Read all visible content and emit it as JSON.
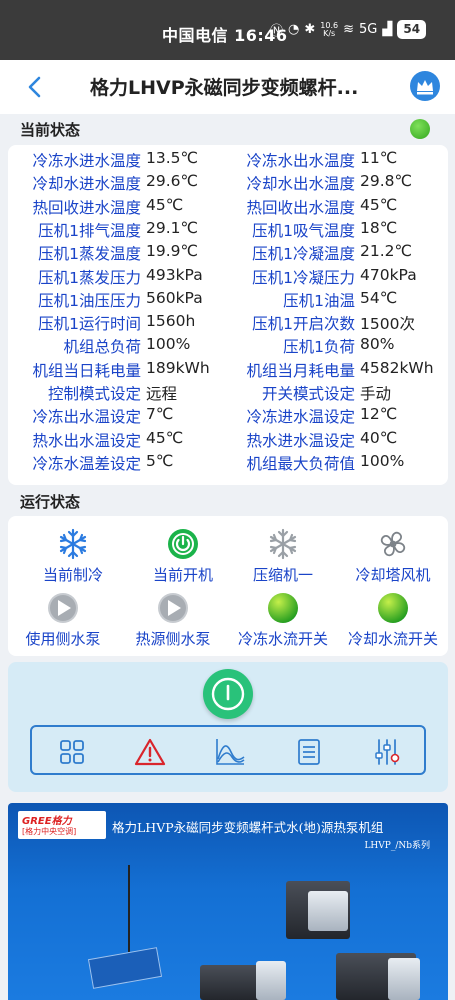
{
  "statusbar": {
    "carrier_time": "中国电信 16:46",
    "net_speed": "10.6\nK/s",
    "signal": "5G",
    "battery": "54"
  },
  "header": {
    "title": "格力LHVP永磁同步变频螺杆..."
  },
  "current_status": {
    "title": "当前状态",
    "rows": [
      {
        "l1": "冷冻水进水温度",
        "v1": "13.5℃",
        "l2": "冷冻水出水温度",
        "v2": "11℃"
      },
      {
        "l1": "冷却水进水温度",
        "v1": "29.6℃",
        "l2": "冷却水出水温度",
        "v2": "29.8℃"
      },
      {
        "l1": "热回收进水温度",
        "v1": "45℃",
        "l2": "热回收出水温度",
        "v2": "45℃"
      },
      {
        "l1": "压机1排气温度",
        "v1": "29.1℃",
        "l2": "压机1吸气温度",
        "v2": "18℃"
      },
      {
        "l1": "压机1蒸发温度",
        "v1": "19.9℃",
        "l2": "压机1冷凝温度",
        "v2": "21.2℃"
      },
      {
        "l1": "压机1蒸发压力",
        "v1": "493kPa",
        "l2": "压机1冷凝压力",
        "v2": "470kPa"
      },
      {
        "l1": "压机1油压压力",
        "v1": "560kPa",
        "l2": "压机1油温",
        "v2": "54℃"
      },
      {
        "l1": "压机1运行时间",
        "v1": "1560h",
        "l2": "压机1开启次数",
        "v2": "1500次"
      },
      {
        "l1": "机组总负荷",
        "v1": "100%",
        "l2": "压机1负荷",
        "v2": "80%"
      },
      {
        "l1": "机组当日耗电量",
        "v1": "189kWh",
        "l2": "机组当月耗电量",
        "v2": "4582kWh"
      },
      {
        "l1": "控制模式设定",
        "v1": "远程",
        "l2": "开关模式设定",
        "v2": "手动"
      },
      {
        "l1": "冷冻出水温设定",
        "v1": "7℃",
        "l2": "冷冻进水温设定",
        "v2": "12℃"
      },
      {
        "l1": "热水出水温设定",
        "v1": "45℃",
        "l2": "热水进水温设定",
        "v2": "40℃"
      },
      {
        "l1": "冷冻水温差设定",
        "v1": "5℃",
        "l2": "机组最大负荷值",
        "v2": "100%"
      }
    ]
  },
  "run_status": {
    "title": "运行状态",
    "items": [
      {
        "label": "当前制冷",
        "icon": "snowflake-icon"
      },
      {
        "label": "当前开机",
        "icon": "power-on-icon"
      },
      {
        "label": "压缩机一",
        "icon": "compressor-snowflake-icon"
      },
      {
        "label": "冷却塔风机",
        "icon": "fan-icon"
      },
      {
        "label": "使用侧水泵",
        "icon": "pump-icon"
      },
      {
        "label": "热源侧水泵",
        "icon": "pump-icon"
      },
      {
        "label": "冷冻水流开关",
        "icon": "flow-switch-icon"
      },
      {
        "label": "冷却水流开关",
        "icon": "flow-switch-icon"
      }
    ]
  },
  "toolbar": {
    "tools": [
      "grid-icon",
      "alarm-icon",
      "curve-chart-icon",
      "list-icon",
      "settings-sliders-icon"
    ]
  },
  "banner": {
    "brand_top": "GREE格力",
    "brand_bottom": "[格力中央空调]",
    "title": "格力LHVP永磁同步变频螺杆式水(地)源热泵机组",
    "subtitle": "LHVP_/Nb系列"
  },
  "colors": {
    "label_blue": "#1a44c8",
    "status_green": "#32a61e",
    "power_green": "#29c27a",
    "accent_blue": "#2f7ccd",
    "alarm_red": "#d9252c"
  }
}
